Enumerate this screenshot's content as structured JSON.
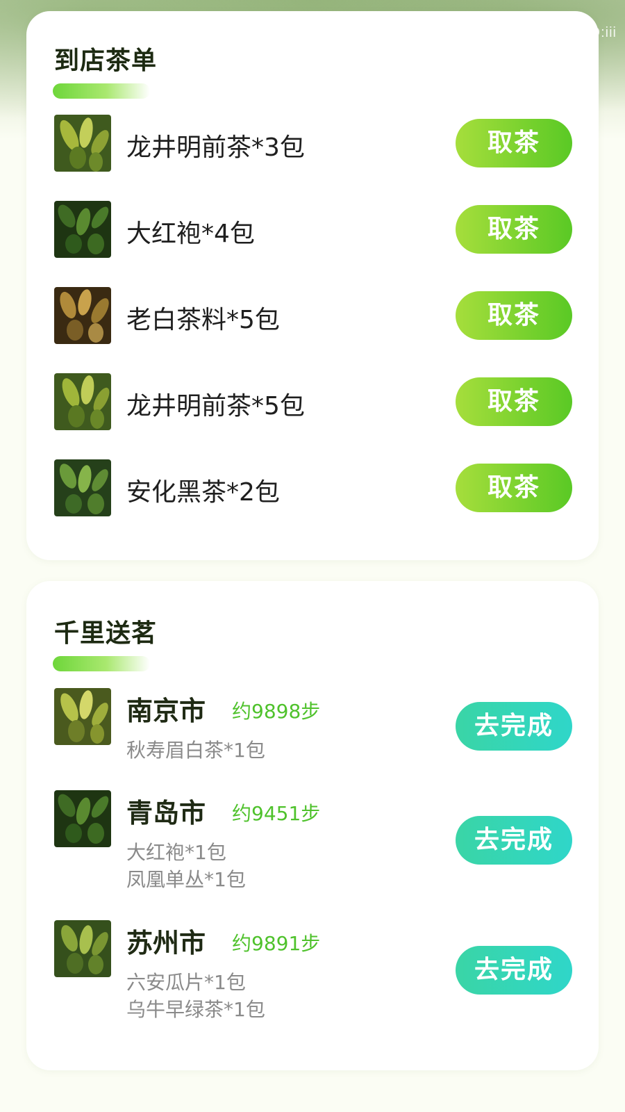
{
  "watermark": "ID:iii",
  "store_section": {
    "title": "到店茶单",
    "items": [
      {
        "name": "龙井明前茶*3包",
        "button": "取茶"
      },
      {
        "name": "大红袍*4包",
        "button": "取茶"
      },
      {
        "name": "老白茶料*5包",
        "button": "取茶"
      },
      {
        "name": "龙井明前茶*5包",
        "button": "取茶"
      },
      {
        "name": "安化黑茶*2包",
        "button": "取茶"
      }
    ]
  },
  "delivery_section": {
    "title": "千里送茗",
    "items": [
      {
        "city": "南京市",
        "steps": "约9898步",
        "teas": [
          "秋寿眉白茶*1包"
        ],
        "button": "去完成"
      },
      {
        "city": "青岛市",
        "steps": "约9451步",
        "teas": [
          "大红袍*1包",
          "凤凰单丛*1包"
        ],
        "button": "去完成"
      },
      {
        "city": "苏州市",
        "steps": "约9891步",
        "teas": [
          "六安瓜片*1包",
          "乌牛早绿茶*1包"
        ],
        "button": "去完成"
      }
    ]
  },
  "colors": {
    "title_text": "#1d2a12",
    "take_button_start": "#a6de3c",
    "take_button_end": "#5ac925",
    "complete_button_start": "#3ad5a6",
    "complete_button_end": "#2fd6c9",
    "steps_text": "#4fc22c",
    "sub_text": "#8a8a8a"
  }
}
